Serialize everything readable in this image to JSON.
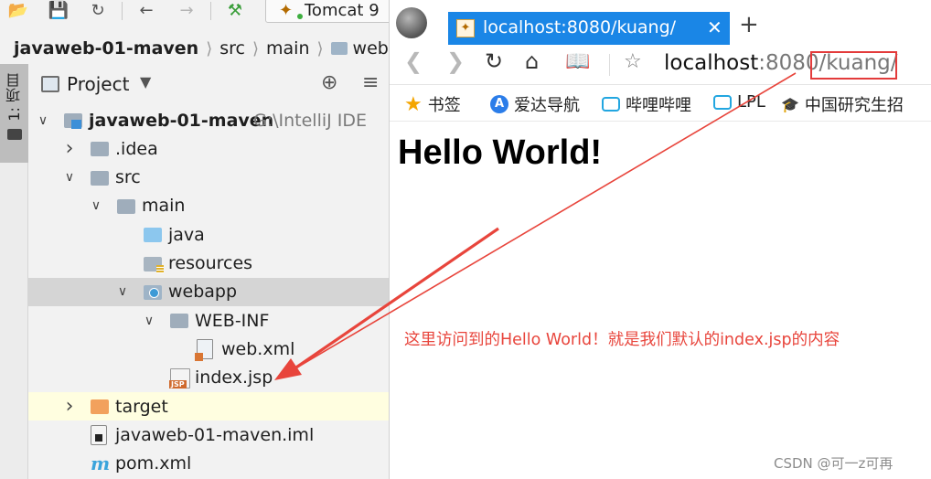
{
  "ide": {
    "run_config": "Tomcat 9",
    "breadcrumb": [
      "javaweb-01-maven",
      "src",
      "main",
      "web"
    ],
    "side_tab_label": "1: 项目",
    "project_panel": {
      "title": "Project",
      "tree": [
        {
          "label": "javaweb-01-maven",
          "hint": "G:\\IntelliJ IDE",
          "icon": "module-folder-icon",
          "arrow": "expanded",
          "bold": true
        },
        {
          "label": ".idea",
          "icon": "folder-icon",
          "arrow": "collapsed"
        },
        {
          "label": "src",
          "icon": "folder-icon",
          "arrow": "expanded"
        },
        {
          "label": "main",
          "icon": "folder-icon",
          "arrow": "expanded"
        },
        {
          "label": "java",
          "icon": "source-folder-icon",
          "arrow": "none"
        },
        {
          "label": "resources",
          "icon": "resources-folder-icon",
          "arrow": "none"
        },
        {
          "label": "webapp",
          "icon": "web-folder-icon",
          "arrow": "expanded",
          "selected": true
        },
        {
          "label": "WEB-INF",
          "icon": "folder-icon",
          "arrow": "expanded"
        },
        {
          "label": "web.xml",
          "icon": "xml-file-icon",
          "arrow": "none"
        },
        {
          "label": "index.jsp",
          "icon": "jsp-file-icon",
          "arrow": "none"
        },
        {
          "label": "target",
          "icon": "excluded-folder-icon",
          "arrow": "collapsed",
          "excluded": true
        },
        {
          "label": "javaweb-01-maven.iml",
          "icon": "iml-file-icon",
          "arrow": "none"
        },
        {
          "label": "pom.xml",
          "icon": "maven-icon",
          "icon_glyph": "m",
          "arrow": "none"
        }
      ]
    }
  },
  "browser": {
    "tab_title": "localhost:8080/kuang/",
    "address": {
      "host": "localhost",
      "port": ":8080",
      "path": "/kuang/"
    },
    "bookmarks": [
      {
        "label": "书签",
        "icon": "star-icon"
      },
      {
        "label": "爱达导航",
        "icon": "aida-icon",
        "icon_glyph": "A"
      },
      {
        "label": "哔哩哔哩",
        "icon": "bilibili-icon"
      },
      {
        "label": "LPL",
        "icon": "bilibili-icon"
      },
      {
        "label": "中国研究生招",
        "icon": "graduation-cap-icon",
        "icon_glyph": "🎓"
      }
    ],
    "page_heading": "Hello World!"
  },
  "annotation": "这里访问到的Hello World！就是我们默认的index.jsp的内容",
  "watermark": "CSDN @可一z可再",
  "colors": {
    "annotation_red": "#e8453c",
    "tab_blue": "#1a86e6",
    "selected_row": "#d5d5d5",
    "excluded_row": "#fffee0"
  }
}
